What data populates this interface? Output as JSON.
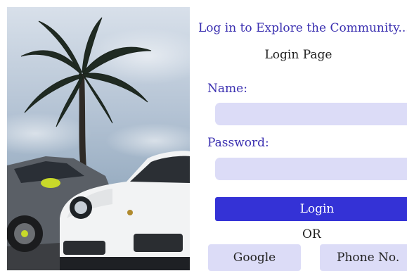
{
  "form": {
    "tagline": "Log in to Explore the Community...",
    "title": "Login Page",
    "name_label": "Name:",
    "name_value": "",
    "password_label": "Password:",
    "password_value": "",
    "login_label": "Login",
    "or_text": "OR",
    "google_label": "Google",
    "phone_label": "Phone No."
  },
  "colors": {
    "accent_text": "#3a2fb0",
    "login_button": "#3432d6",
    "field_background": "#dcdcf7"
  },
  "photo": {
    "subject": "palm-tree-and-sports-cars-photo"
  }
}
